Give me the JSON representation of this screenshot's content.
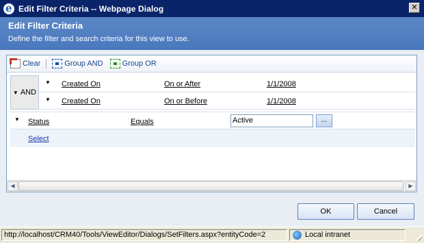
{
  "window": {
    "title": "Edit Filter Criteria -- Webpage Dialog",
    "close_glyph": "✕"
  },
  "header": {
    "title": "Edit Filter Criteria",
    "subtitle": "Define the filter and search criteria for this view to use."
  },
  "toolbar": {
    "clear_label": "Clear",
    "group_and_label": "Group AND",
    "group_or_label": "Group OR"
  },
  "group": {
    "operator": "AND",
    "conditions": [
      {
        "field": "Created On",
        "operator": "On or After",
        "value": "1/1/2008"
      },
      {
        "field": "Created On",
        "operator": "On or Before",
        "value": "1/1/2008"
      }
    ]
  },
  "status_condition": {
    "field": "Status",
    "operator": "Equals",
    "value": "Active",
    "lookup_label": "..."
  },
  "select_link": "Select",
  "buttons": {
    "ok": "OK",
    "cancel": "Cancel"
  },
  "statusbar": {
    "url": "http://localhost/CRM40/Tools/ViewEditor/Dialogs/SetFilters.aspx?entityCode=2",
    "zone": "Local intranet"
  },
  "icons": {
    "app": "ie-icon",
    "clear": "clear-icon",
    "group_and": "group-and-icon",
    "group_or": "group-or-icon",
    "zone": "intranet-icon"
  },
  "colors": {
    "titlebar": "#0a246a",
    "header": "#4a78bd",
    "link": "#1535a3",
    "toolbar_text": "#15428b"
  }
}
